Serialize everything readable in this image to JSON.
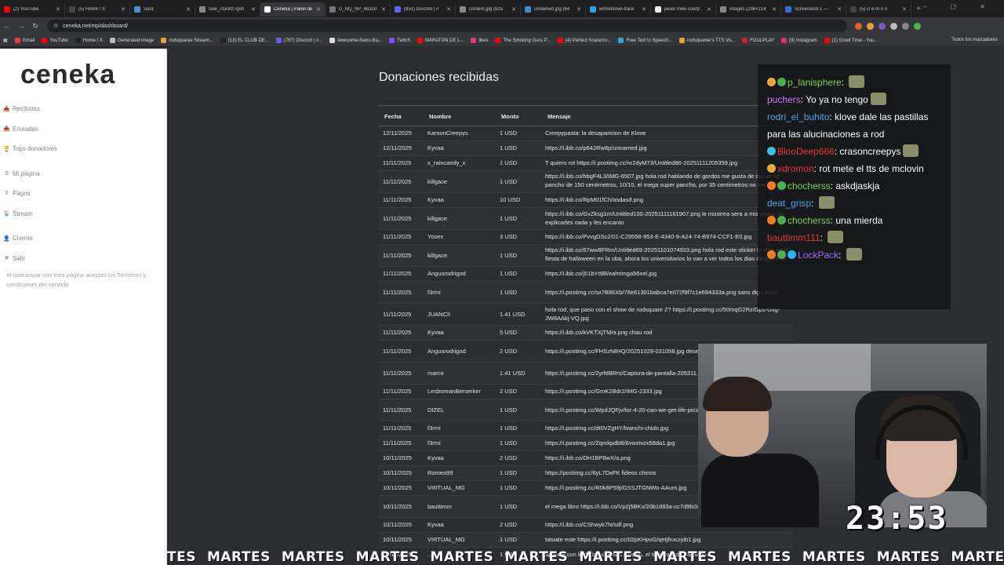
{
  "browser": {
    "tabs": [
      {
        "label": "(2) YouTube",
        "color": "#ff0000"
      },
      {
        "label": "(5) Home / X",
        "color": "#444444"
      },
      {
        "label": "Sora",
        "color": "#4a90d9"
      },
      {
        "label": "task_01k9tz7gsh",
        "color": "#888888"
      },
      {
        "label": "Ceneka | Panel de",
        "color": "#ffffff",
        "active": true
      },
      {
        "label": "D_NQ_NP_66320",
        "color": "#777777"
      },
      {
        "label": "(851) Discord | #",
        "color": "#5865f2"
      },
      {
        "label": "content.jpg (825",
        "color": "#888888"
      },
      {
        "label": "unnamed.jpg (64",
        "color": "#3b8ed6"
      },
      {
        "label": "wmremove-trans",
        "color": "#2ea0f0"
      },
      {
        "label": "javier milei cuerp",
        "color": "#eeeeee"
      },
      {
        "label": "images (236×214",
        "color": "#888888"
      },
      {
        "label": "Screenshot 1 — ",
        "color": "#3a6bd8"
      },
      {
        "label": "(5) D e m o n",
        "color": "#444444"
      }
    ],
    "url": "ceneka.net/mp/dashboard/",
    "bookmarks": [
      {
        "label": "Gmail",
        "color": "#ea4335"
      },
      {
        "label": "YouTube",
        "color": "#ff0000"
      },
      {
        "label": "Home / X",
        "color": "#222222"
      },
      {
        "label": "Generated image",
        "color": "#bbbbbb"
      },
      {
        "label": "rodsquaree Stream...",
        "color": "#e8a23b"
      },
      {
        "label": "(13) EL CLUB DE...",
        "color": "#222222"
      },
      {
        "label": "(787) Discord | #...",
        "color": "#5865f2"
      },
      {
        "label": "Awesome-Nano-Ba...",
        "color": "#dddddd"
      },
      {
        "label": "Twitch",
        "color": "#9146ff"
      },
      {
        "label": "MARATON DE L...",
        "color": "#ff0000"
      },
      {
        "label": "likes",
        "color": "#e03a8a"
      },
      {
        "label": "The Smoking Guru P...",
        "color": "#ff0000"
      },
      {
        "label": "(4) Perfect Scarecro...",
        "color": "#ff0000"
      },
      {
        "label": "Free Text to Speech...",
        "color": "#3aa0e0"
      },
      {
        "label": "rodsquaree's TTS Vo...",
        "color": "#e8a23b"
      },
      {
        "label": "FOULPLAY",
        "color": "#cc2222"
      },
      {
        "label": "(9) Instagram",
        "color": "#e1306c"
      },
      {
        "label": "(1) Good Time - You...",
        "color": "#ff0000"
      }
    ],
    "all_bookmarks": "Todos los marcadores"
  },
  "sidebar": {
    "logo": "ceneka",
    "items": [
      {
        "icon": "📥",
        "label": "Recibidas"
      },
      {
        "icon": "📤",
        "label": "Enviadas"
      },
      {
        "icon": "🏆",
        "label": "Tops donadores"
      },
      {
        "icon": "⚙",
        "label": "Mi página"
      },
      {
        "icon": "$",
        "label": "Pagos"
      },
      {
        "icon": "📡",
        "label": "Stream"
      },
      {
        "icon": "👤",
        "label": "Cuenta"
      },
      {
        "icon": "✖",
        "label": "Salir"
      }
    ],
    "terms": "Al interactuar con esta página aceptas los Términos y condiciones del servicio"
  },
  "main": {
    "title": "Donaciones recibidas",
    "columns": [
      "Fecha",
      "Nombre",
      "Monto",
      "Mensaje"
    ],
    "rows": [
      {
        "fecha": "12/11/2025",
        "nombre": "KarsonCreepys",
        "monto": "1 USD",
        "mensaje": "Creepypasta: la desaparicion de Klove",
        "h": 1
      },
      {
        "fecha": "12/11/2025",
        "nombre": "Kyvaa",
        "monto": "1 USD",
        "mensaje": "https://i.ibb.co/p642Rw8p/unnamed.jpg",
        "h": 1
      },
      {
        "fecha": "11/11/2025",
        "nombre": "x_raincandy_x",
        "monto": "1 USD",
        "mensaje": "T quiero rot https://i.postimg.cc/nr2dyM73/Untitled86-20251111205359.jpg",
        "h": 1
      },
      {
        "fecha": "11/11/2025",
        "nombre": "killgace",
        "monto": "1 USD",
        "mensaje": "https://i.ibb.co/hbgF4L3/IMG-6507.jpg hola rod hablando de gordos me gusta de comer un pancho de 150 centimetros, 10/10, el mega super pancho, por 35 centimetros no me paso en altura adewwr",
        "h": 2
      },
      {
        "fecha": "11/11/2025",
        "nombre": "Kyvaa",
        "monto": "10 USD",
        "mensaje": "https://i.ibb.co/RpM01fCh/asdasd.png",
        "h": 1
      },
      {
        "fecha": "11/11/2025",
        "nombre": "killgace",
        "monto": "1 USD",
        "mensaje": "https://i.ibb.co/GvZksg1m/Untitled130-20251111161907.png le mostrea sera a mis viejos sin explicarles nada y les encanto",
        "h": 2
      },
      {
        "fecha": "11/11/2025",
        "nombre": "Yosex",
        "monto": "3 USD",
        "mensaje": "https://i.ibb.co/PvvgDSc2/01-C29558-953-E-4340-9-A24-74-B974-CCF1-E0.jpg",
        "h": 1
      },
      {
        "fecha": "11/11/2025",
        "nombre": "killgace",
        "monto": "1 USD",
        "mensaje": "https://i.ibb.co/67ww8FRm/Untitled69-20251101074933.png hola rod este sticker lo deje en la fiesta de halloween en la uba, ahora los universitarios lo van a ver todos los dias despues de estudiar",
        "h": 2
      },
      {
        "fecha": "11/11/2025",
        "nombre": "Angusrodrigod",
        "monto": "1 USD",
        "mensaje": "https://i.ibb.co/j51bYt9B/eahrimga56xel.jpg",
        "h": 1
      },
      {
        "fecha": "11/11/2025",
        "nombre": "f3rmi",
        "monto": "1 USD",
        "mensaje": "https://i.postimg.cc/sx7B86Xb/76e61301babca7e072f9f7c1e694333a.png sans digo trans",
        "h": 2
      },
      {
        "fecha": "11/11/2025",
        "nombre": "JUANCII",
        "monto": "1.41 USD",
        "mensaje": "hola rod, que paso con el show de rodsquare 2? https://i.postimg.cc/50mqG2Rz/Gps-Gxg-JW8AAkj-VQ.jpg",
        "h": 2
      },
      {
        "fecha": "11/11/2025",
        "nombre": "Kyvaa",
        "monto": "5 USD",
        "mensaje": "https://i.ibb.co/kVKTXjTM/a.png chau rod",
        "h": 1
      },
      {
        "fecha": "11/11/2025",
        "nombre": "Angusrodrigod",
        "monto": "2 USD",
        "mensaje": "https://i.postimg.cc/FHSzh8HQ/20251028-031058.jpg deseo buenas noches",
        "h": 2
      },
      {
        "fecha": "11/11/2025",
        "nombre": "marce",
        "monto": "1.41 USD",
        "mensaje": "https://i.postimg.cc/2yrMBRrs/Captura-de-pantalla-205311.png",
        "h": 2
      },
      {
        "fecha": "11/11/2025",
        "nombre": "LesboreanBerserker",
        "monto": "2 USD",
        "mensaje": "https://i.postimg.cc/GmK2Bdr2/IMG-2333.jpg",
        "h": 1
      },
      {
        "fecha": "11/11/2025",
        "nombre": "DIZEL",
        "monto": "1 USD",
        "mensaje": "https://i.postimg.cc/WpdJQFjv/for-4-20-can-we-get-life-pics-they-r-v0-74ep9cwqj5va1-jpg.jpg",
        "h": 2
      },
      {
        "fecha": "11/11/2025",
        "nombre": "f3rmi",
        "monto": "1 USD",
        "mensaje": "https://i.postimg.cc/dt0VZgHY/bianchi-chido.jpg",
        "h": 1
      },
      {
        "fecha": "11/11/2025",
        "nombre": "f3rmi",
        "monto": "1 USD",
        "mensaje": "https://i.postimg.cc/ZqmkpdbB/6vwzivzx58da1.jpg",
        "h": 1
      },
      {
        "fecha": "10/11/2025",
        "nombre": "Kyvaa",
        "monto": "2 USD",
        "mensaje": "https://i.ibb.co/DH1BP8wX/a.png",
        "h": 1
      },
      {
        "fecha": "10/11/2025",
        "nombre": "Romeo99",
        "monto": "1 USD",
        "mensaje": "https://postimg.cc/6yL7DxFK fideos chinos",
        "h": 1
      },
      {
        "fecha": "10/11/2025",
        "nombre": "VIRTUAL_MG",
        "monto": "1 USD",
        "mensaje": "https://i.postimg.cc/R0k8P59j/GSSJTGNWo-AAum.jpg",
        "h": 1
      },
      {
        "fecha": "10/11/2025",
        "nombre": "bauttimm",
        "monto": "1 USD",
        "mensaje": "el mega libro https://i.ibb.co/Vp2j5BKs/20b1883a-cc7d9fc0d28b.jpg",
        "h": 2
      },
      {
        "fecha": "10/11/2025",
        "nombre": "Kyvaa",
        "monto": "2 USD",
        "mensaje": "https://i.ibb.co/CShwyk7N/sdf.png",
        "h": 1
      },
      {
        "fecha": "10/11/2025",
        "nombre": "VIRTUAL_MG",
        "monto": "1 USD",
        "mensaje": "tatuate este https://i.postimg.cc/02pKHpvG/qetjfruczyib1.jpg",
        "h": 1
      },
      {
        "fecha": "10/11/2025",
        "nombre": "...",
        "monto": "1 USD",
        "mensaje": "apurate con lo de las cuentas filosofo, el tiempo esta pasando...",
        "h": 1
      }
    ]
  },
  "chat": [
    {
      "badges": [
        "#f2a93b",
        "#4caf50"
      ],
      "user": "p_lanisphere",
      "color": "#7bd44b",
      "msg": "",
      "emote": true
    },
    {
      "badges": [],
      "user": "puchers",
      "color": "#c77dff",
      "msg": "Yo ya no tengo",
      "emote": true
    },
    {
      "badges": [],
      "user": "rodri_el_buhito",
      "color": "#3fa9f5",
      "msg": "klove dale las pastillas para las alucinaciones a rod",
      "emote": false
    },
    {
      "badges": [
        "#3fb9e8"
      ],
      "user": "BlooDeep666",
      "color": "#e53935",
      "msg": "crasoncreepys",
      "emote": true
    },
    {
      "badges": [
        "#f2a93b"
      ],
      "user": "xdromon",
      "color": "#e53935",
      "msg": "rot mete el tts de mclovin",
      "emote": false
    },
    {
      "badges": [
        "#f27c1e",
        "#4caf50"
      ],
      "user": "chocherss",
      "color": "#7bd44b",
      "msg": "askdjaskja",
      "emote": false
    },
    {
      "badges": [],
      "user": "deat_grisp",
      "color": "#3fa9f5",
      "msg": "",
      "emote": true
    },
    {
      "badges": [
        "#f27c1e",
        "#4caf50"
      ],
      "user": "chocherss",
      "color": "#7bd44b",
      "msg": "una mierda",
      "emote": false
    },
    {
      "badges": [],
      "user": "bauttimm111",
      "color": "#e53935",
      "msg": "",
      "emote": true
    },
    {
      "badges": [
        "#f27c1e",
        "#4caf50",
        "#29b6f6"
      ],
      "user": "LockPack",
      "color": "#9c6bff",
      "msg": "",
      "emote": true
    }
  ],
  "timer": "23:53",
  "ticker": [
    "TES",
    "MARTES",
    "MARTES",
    "MARTES",
    "MARTES",
    "MARTES",
    "MARTES",
    "MARTES",
    "MARTES",
    "MARTES",
    "MARTES",
    "MARTES",
    "MARTES",
    "MARTES",
    "MARTES"
  ]
}
